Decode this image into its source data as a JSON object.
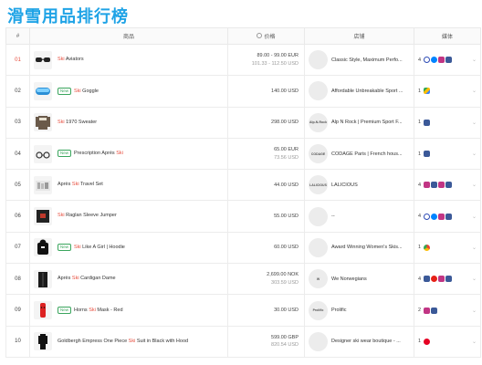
{
  "page": {
    "title": "滑雪用品排行榜"
  },
  "headers": {
    "num": "#",
    "product": "商品",
    "price": "价格",
    "store": "店铺",
    "media": "媒体"
  },
  "colors": {
    "title": "#1fa3e6",
    "rank_top": "#e74c3c",
    "rank_normal": "#3b6fbf",
    "highlight": "#e74c3c",
    "new_tag": "#3aa55d"
  },
  "rows": [
    {
      "rank": "01",
      "name_pre": "",
      "keyword": "Ski",
      "name_post": " Aviators",
      "new_tag": "",
      "thumb": "goggles-black",
      "price1": "89.00 - 99.00 EUR",
      "price2": "101.33 - 112.50 USD",
      "store_logo": "",
      "store": "Classic Style, Maximum Perfo...",
      "media_count": "4",
      "media_icons": [
        "thr",
        "msg",
        "ig",
        "fb"
      ]
    },
    {
      "rank": "02",
      "name_pre": "",
      "keyword": "Ski",
      "name_post": " Goggle",
      "new_tag": "New",
      "thumb": "goggles-blue",
      "price1": "140.00 USD",
      "price2": "",
      "store_logo": "",
      "store": "Affordable Unbreakable Sport ...",
      "media_count": "1",
      "media_icons": [
        "gdr"
      ]
    },
    {
      "rank": "03",
      "name_pre": "",
      "keyword": "Ski",
      "name_post": " 1970 Sweater",
      "new_tag": "",
      "thumb": "sweater",
      "price1": "298.00 USD",
      "price2": "",
      "store_logo": "Alp-N-Rock",
      "store": "Alp N Rock | Premium Sport F...",
      "media_count": "1",
      "media_icons": [
        "fb"
      ]
    },
    {
      "rank": "04",
      "name_pre": "Prescription Après ",
      "keyword": "Ski",
      "name_post": "",
      "new_tag": "New",
      "thumb": "glasses",
      "price1": "65.00 EUR",
      "price2": "73.56 USD",
      "store_logo": "CODAGE",
      "store": "CODAGE Paris | French hous...",
      "media_count": "1",
      "media_icons": [
        "fb"
      ]
    },
    {
      "rank": "05",
      "name_pre": "Après ",
      "keyword": "Ski",
      "name_post": " Travel Set",
      "new_tag": "",
      "thumb": "set",
      "price1": "44.00 USD",
      "price2": "",
      "store_logo": "LALICIOUS",
      "store": "LALICIOUS",
      "media_count": "4",
      "media_icons": [
        "ig",
        "fb",
        "ig",
        "fb"
      ]
    },
    {
      "rank": "06",
      "name_pre": "",
      "keyword": "Ski",
      "name_post": " Raglan Sleeve Jumper",
      "new_tag": "",
      "thumb": "jumper",
      "price1": "55.00 USD",
      "price2": "",
      "store_logo": "",
      "store": "--",
      "media_count": "4",
      "media_icons": [
        "thr",
        "msg",
        "ig",
        "fb"
      ]
    },
    {
      "rank": "07",
      "name_pre": "",
      "keyword": "Ski",
      "name_post": " Like A Girl | Hoodie",
      "new_tag": "New",
      "thumb": "hoodie",
      "price1": "60.00 USD",
      "price2": "",
      "store_logo": "",
      "store": "Award Winning Women's Skis...",
      "media_count": "1",
      "media_icons": [
        "chr"
      ]
    },
    {
      "rank": "08",
      "name_pre": "Après ",
      "keyword": "Ski",
      "name_post": " Cardigan Dame",
      "new_tag": "",
      "thumb": "cardigan",
      "price1": "2,699.00 NOK",
      "price2": "303.59 USD",
      "store_logo": "W",
      "store": "We Norwegians",
      "media_count": "4",
      "media_icons": [
        "fb",
        "yt",
        "ig",
        "fb"
      ]
    },
    {
      "rank": "09",
      "name_pre": "Horns ",
      "keyword": "Ski",
      "name_post": " Mask - Red",
      "new_tag": "New",
      "thumb": "mask",
      "price1": "30.00 USD",
      "price2": "",
      "store_logo": "Prolific",
      "store": "Prolific",
      "media_count": "2",
      "media_icons": [
        "ig",
        "fb"
      ]
    },
    {
      "rank": "10",
      "name_pre": "Goldbergh Empress One Piece ",
      "keyword": "Ski",
      "name_post": " Suit in Black with Hood",
      "new_tag": "",
      "thumb": "suit",
      "price1": "599.00 GBP",
      "price2": "820.54 USD",
      "store_logo": "",
      "store": "Designer ski wear boutique - ...",
      "media_count": "1",
      "media_icons": [
        "pin"
      ]
    }
  ]
}
